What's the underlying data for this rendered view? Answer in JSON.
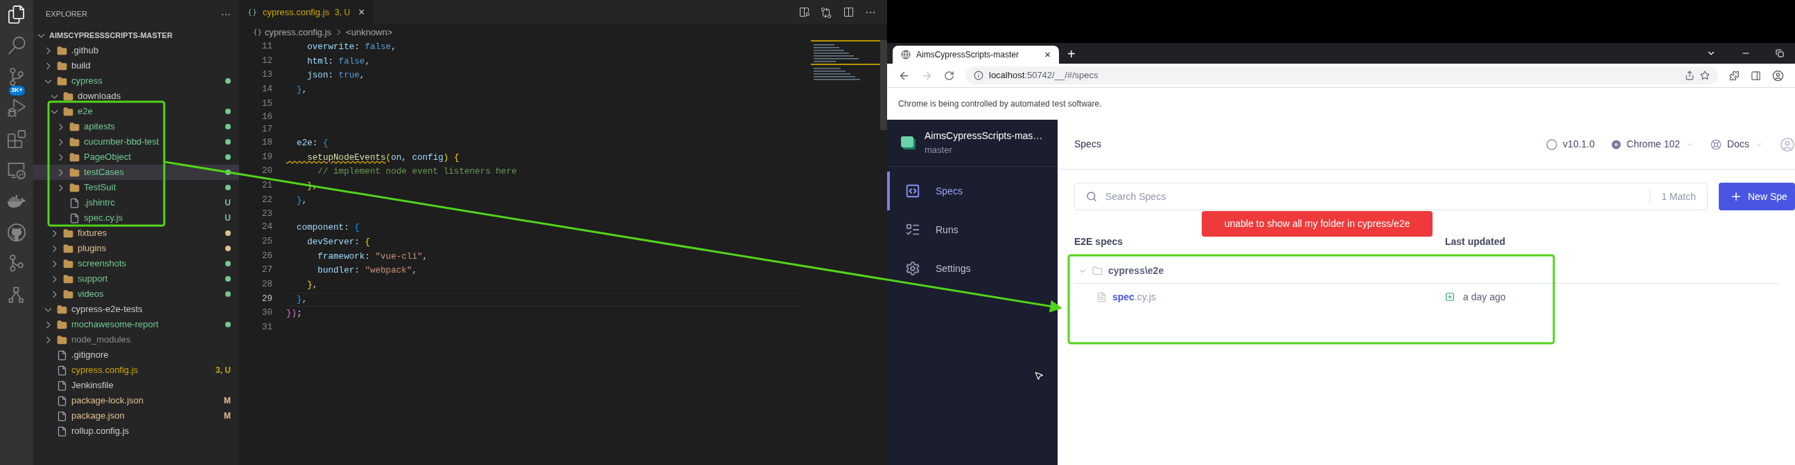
{
  "activity_bar": {
    "items": [
      {
        "selected": true
      },
      {
        "selected": false
      },
      {
        "selected": false,
        "badge": "3K+"
      },
      {
        "selected": false
      },
      {
        "selected": false
      },
      {
        "selected": false
      },
      {
        "selected": false
      },
      {
        "selected": false
      },
      {
        "selected": false
      },
      {
        "selected": false
      }
    ]
  },
  "explorer": {
    "title": "EXPLORER",
    "more": "···",
    "root": {
      "name": "AIMSCYPRESSSCRIPTS-MASTER",
      "expanded": true
    },
    "tree": [
      {
        "kind": "folder",
        "name": ".github",
        "expanded": false,
        "color": "#cccccc",
        "dot": false,
        "selected": false
      },
      {
        "kind": "folder",
        "name": "build",
        "expanded": false,
        "color": "#cccccc",
        "dot": false,
        "selected": false
      },
      {
        "kind": "folder",
        "name": "cypress",
        "expanded": true,
        "color": "#73c991",
        "dot": true,
        "selected": false,
        "children": [
          {
            "kind": "folder",
            "name": "downloads",
            "expanded": true,
            "color": "#cccccc",
            "dot": false,
            "selected": false
          },
          {
            "kind": "folder",
            "name": "e2e",
            "expanded": true,
            "color": "#73c991",
            "dot": true,
            "selected": false,
            "children": [
              {
                "kind": "folder",
                "name": "apitests",
                "expanded": false,
                "color": "#73c991",
                "dot": true,
                "selected": false
              },
              {
                "kind": "folder",
                "name": "cucumber-bbd-test",
                "expanded": false,
                "color": "#73c991",
                "dot": true,
                "selected": false
              },
              {
                "kind": "folder",
                "name": "PageObject",
                "expanded": false,
                "color": "#73c991",
                "dot": true,
                "selected": false
              },
              {
                "kind": "folder",
                "name": "testCases",
                "expanded": false,
                "color": "#73c991",
                "dot": true,
                "selected": true
              },
              {
                "kind": "folder",
                "name": "TestSuit",
                "expanded": false,
                "color": "#73c991",
                "dot": true,
                "selected": false
              },
              {
                "kind": "file",
                "name": ".jshintrc",
                "color": "#73c991",
                "dot": false,
                "badge": "U",
                "selected": false
              },
              {
                "kind": "file",
                "name": "spec.cy.js",
                "color": "#73c991",
                "dot": false,
                "badge": "U",
                "selected": false
              }
            ]
          },
          {
            "kind": "folder",
            "name": "fixtures",
            "expanded": false,
            "color": "#e2c08d",
            "dot": true,
            "selected": false
          },
          {
            "kind": "folder",
            "name": "plugins",
            "expanded": false,
            "color": "#e2c08d",
            "dot": true,
            "selected": false
          },
          {
            "kind": "folder",
            "name": "screenshots",
            "expanded": false,
            "color": "#73c991",
            "dot": true,
            "selected": false
          },
          {
            "kind": "folder",
            "name": "support",
            "expanded": false,
            "color": "#73c991",
            "dot": true,
            "selected": false
          },
          {
            "kind": "folder",
            "name": "videos",
            "expanded": false,
            "color": "#73c991",
            "dot": true,
            "selected": false
          }
        ]
      },
      {
        "kind": "folder",
        "name": "cypress-e2e-tests",
        "expanded": true,
        "color": "#cccccc",
        "dot": false,
        "selected": false
      },
      {
        "kind": "folder",
        "name": "mochawesome-report",
        "expanded": false,
        "color": "#73c991",
        "dot": true,
        "selected": false
      },
      {
        "kind": "folder",
        "name": "node_modules",
        "expanded": false,
        "color": "#8c8c8c",
        "dot": false,
        "selected": false
      },
      {
        "kind": "file",
        "name": ".gitignore",
        "color": "#cccccc",
        "dot": false,
        "selected": false
      },
      {
        "kind": "file",
        "name": "cypress.config.js",
        "color": "#cca700",
        "dot": false,
        "badge": "3, U",
        "selected": false
      },
      {
        "kind": "file",
        "name": "Jenkinsfile",
        "color": "#cccccc",
        "dot": false,
        "selected": false
      },
      {
        "kind": "file",
        "name": "package-lock.json",
        "color": "#e2c08d",
        "dot": false,
        "badge": "M",
        "selected": false
      },
      {
        "kind": "file",
        "name": "package.json",
        "color": "#e2c08d",
        "dot": false,
        "badge": "M",
        "selected": false
      },
      {
        "kind": "file",
        "name": "rollup.config.js",
        "color": "#cccccc",
        "dot": false,
        "selected": false
      }
    ]
  },
  "editor": {
    "tab": {
      "name": "cypress.config.js",
      "badge": "3, U",
      "close": "×"
    },
    "breadcrumb": [
      "cypress.config.js",
      "<unknown>"
    ],
    "lines": [
      {
        "number": "11",
        "current": false,
        "tokens": [
          {
            "kind": "key",
            "text": "    overwrite"
          },
          {
            "kind": "punct",
            "text": ": "
          },
          {
            "kind": "bool",
            "text": "false"
          },
          {
            "kind": "punct",
            "text": ","
          }
        ]
      },
      {
        "number": "12",
        "current": false,
        "tokens": [
          {
            "kind": "key",
            "text": "    html"
          },
          {
            "kind": "punct",
            "text": ": "
          },
          {
            "kind": "bool",
            "text": "false"
          },
          {
            "kind": "punct",
            "text": ","
          }
        ]
      },
      {
        "number": "13",
        "current": false,
        "tokens": [
          {
            "kind": "key",
            "text": "    json"
          },
          {
            "kind": "punct",
            "text": ": "
          },
          {
            "kind": "bool",
            "text": "true"
          },
          {
            "kind": "punct",
            "text": ","
          }
        ]
      },
      {
        "number": "14",
        "current": false,
        "tokens": [
          {
            "kind": "brace3",
            "text": "  }"
          },
          {
            "kind": "punct",
            "text": ","
          }
        ]
      },
      {
        "number": "15",
        "current": false
      },
      {
        "number": "16",
        "current": false
      },
      {
        "number": "17",
        "current": false
      },
      {
        "number": "18",
        "current": false,
        "tokens": [
          {
            "kind": "key",
            "text": "  e2e"
          },
          {
            "kind": "punct",
            "text": ": "
          },
          {
            "kind": "brace3",
            "text": "{"
          }
        ]
      },
      {
        "number": "19",
        "current": false,
        "tokens": [
          {
            "kind": "flagged",
            "text": "    setupNodeEvents"
          },
          {
            "kind": "brace1",
            "text": "("
          },
          {
            "kind": "param",
            "text": "on"
          },
          {
            "kind": "punct",
            "text": ", "
          },
          {
            "kind": "param",
            "text": "config"
          },
          {
            "kind": "brace1",
            "text": ")"
          },
          {
            "kind": "brace1",
            "text": " {"
          }
        ]
      },
      {
        "number": "20",
        "current": false,
        "tokens": [
          {
            "kind": "comment",
            "text": "      // implement node event listeners here"
          }
        ]
      },
      {
        "number": "21",
        "current": false,
        "tokens": [
          {
            "kind": "brace1",
            "text": "    }"
          },
          {
            "kind": "punct",
            "text": ","
          }
        ]
      },
      {
        "number": "22",
        "current": false,
        "tokens": [
          {
            "kind": "brace3",
            "text": "  }"
          },
          {
            "kind": "punct",
            "text": ","
          }
        ]
      },
      {
        "number": "23",
        "current": false
      },
      {
        "number": "24",
        "current": false,
        "tokens": [
          {
            "kind": "key",
            "text": "  component"
          },
          {
            "kind": "punct",
            "text": ": "
          },
          {
            "kind": "brace3",
            "text": "{"
          }
        ]
      },
      {
        "number": "25",
        "current": false,
        "tokens": [
          {
            "kind": "key",
            "text": "    devServer"
          },
          {
            "kind": "punct",
            "text": ": "
          },
          {
            "kind": "brace1",
            "text": "{"
          }
        ]
      },
      {
        "number": "26",
        "current": false,
        "tokens": [
          {
            "kind": "key",
            "text": "      framework"
          },
          {
            "kind": "punct",
            "text": ": "
          },
          {
            "kind": "string",
            "text": "\"vue-cli\""
          },
          {
            "kind": "punct",
            "text": ","
          }
        ]
      },
      {
        "number": "27",
        "current": false,
        "tokens": [
          {
            "kind": "key",
            "text": "      bundler"
          },
          {
            "kind": "punct",
            "text": ": "
          },
          {
            "kind": "string",
            "text": "\"webpack\""
          },
          {
            "kind": "punct",
            "text": ","
          }
        ]
      },
      {
        "number": "28",
        "current": false,
        "tokens": [
          {
            "kind": "brace1",
            "text": "    }"
          },
          {
            "kind": "punct",
            "text": ","
          }
        ]
      },
      {
        "number": "29",
        "current": true,
        "tokens": [
          {
            "kind": "brace3",
            "text": "  }"
          },
          {
            "kind": "punct",
            "text": ","
          }
        ]
      },
      {
        "number": "30",
        "current": false,
        "tokens": [
          {
            "kind": "brace2",
            "text": "})"
          },
          {
            "kind": "punct",
            "text": ";"
          }
        ]
      },
      {
        "number": "31",
        "current": false
      }
    ]
  },
  "browser": {
    "tab": {
      "title": "AimsCypressScripts-master",
      "close": "×"
    },
    "new_tab": "+",
    "address": {
      "host": "localhost",
      "path": ":50742/__/#/specs"
    },
    "infobar": "Chrome is being controlled by automated test software."
  },
  "cypress": {
    "project": {
      "name": "AimsCypressScripts-mas…",
      "branch": "master"
    },
    "nav": [
      {
        "label": "Specs",
        "selected": true
      },
      {
        "label": "Runs",
        "selected": false
      },
      {
        "label": "Settings",
        "selected": false
      }
    ],
    "header": {
      "title": "Specs",
      "version": "v10.1.0",
      "browser": "Chrome 102",
      "docs": "Docs"
    },
    "search": {
      "placeholder": "Search Specs",
      "matches": "1 Match"
    },
    "new_spec": "New Spe",
    "columns": [
      "E2E specs",
      "Last updated"
    ],
    "folder": {
      "name": "cypress\\e2e",
      "expanded": true
    },
    "specs": [
      {
        "name": "spec",
        "ext": ".cy.js",
        "updated": "a day ago"
      }
    ]
  },
  "annotation": {
    "text": "unable to show all my folder in cypress/e2e"
  }
}
